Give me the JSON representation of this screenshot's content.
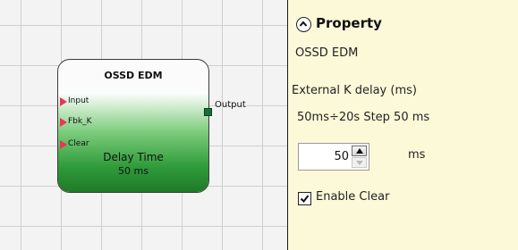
{
  "block": {
    "title": "OSSD EDM",
    "inputs": [
      "Input",
      "Fbk_K",
      "Clear"
    ],
    "output": "Output",
    "delay_label": "Delay Time",
    "delay_value": "50 ms"
  },
  "panel": {
    "title": "Property",
    "block_name": "OSSD EDM",
    "delay_param_label": "External K delay (ms)",
    "range_text": "50ms÷20s Step 50 ms",
    "delay_input_value": "50",
    "unit": "ms",
    "enable_clear_label": "Enable Clear",
    "enable_clear_checked": true
  },
  "colors": {
    "panel_bg": "#fcf9d9",
    "input_pin": "#e8365a",
    "output_pin": "#1b6d3b",
    "block_green": "#2f9b3a"
  },
  "icons": {
    "collapse": "chevron-up-circle-icon",
    "spin_up": "triangle-up-icon",
    "spin_down": "triangle-down-icon",
    "checkbox": "checkmark-icon"
  }
}
